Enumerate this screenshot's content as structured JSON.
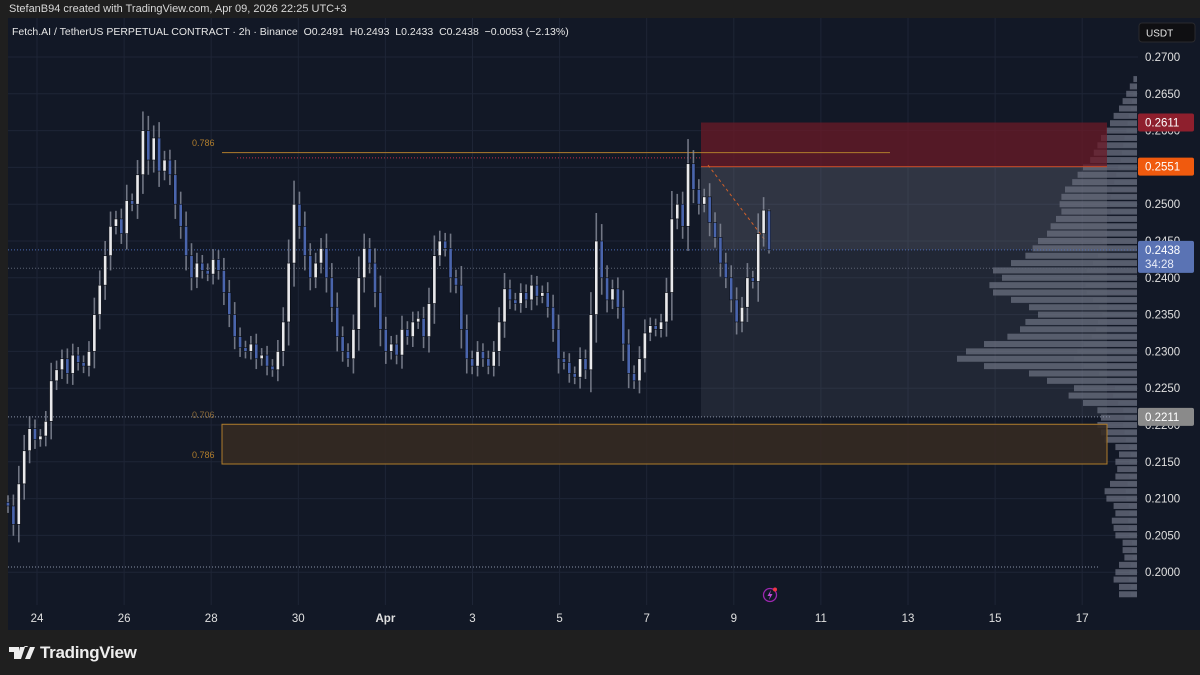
{
  "attribution": "StefanB94 created with TradingView.com, Apr 09, 2026 22:25 UTC+3",
  "legend": {
    "symbol": "Fetch.AI / TetherUS PERPETUAL CONTRACT · 2h · Binance",
    "open": "O0.2491",
    "high": "H0.2493",
    "low": "L0.2433",
    "close": "C0.2438",
    "change": "−0.0053 (−2.13%)"
  },
  "currency": "USDT",
  "footer": {
    "brand": "TradingView"
  },
  "colors": {
    "background": "#121826",
    "up_body": "#e9e9ec",
    "down_body": "#4a65ad",
    "wick": "#8a8f9c",
    "supply_zone": "#6b1a27",
    "fib_zone": "#352a22",
    "fib_line": "#b07d2c",
    "label_red": "#8e1f2d",
    "label_orange": "#f05a0e",
    "label_blue": "#5a73b4",
    "label_gray": "#8a8a8a"
  },
  "price_labels": [
    {
      "value": "0.2611",
      "kind": "red"
    },
    {
      "value": "0.2551",
      "kind": "orange"
    },
    {
      "value": "0.2438",
      "kind": "blue",
      "countdown": "34:28"
    },
    {
      "value": "0.2211",
      "kind": "gray"
    }
  ],
  "fib_labels": {
    "upper_level": "0.786",
    "lower_top": "0.706",
    "lower_bottom": "0.786"
  },
  "chart_data": {
    "type": "candlestick",
    "interval": "2h",
    "ylim": [
      0.1965,
      0.2745
    ],
    "y_ticks": [
      "0.2700",
      "0.2650",
      "0.2600",
      "0.2550",
      "0.2500",
      "0.2450",
      "0.2400",
      "0.2350",
      "0.2300",
      "0.2250",
      "0.2200",
      "0.2150",
      "0.2100",
      "0.2050",
      "0.2000"
    ],
    "x_ticks": [
      "24",
      "26",
      "28",
      "30",
      "Apr",
      "3",
      "5",
      "7",
      "9",
      "11",
      "13",
      "15",
      "17"
    ],
    "grid": true,
    "closes": [
      0.209,
      0.2065,
      0.212,
      0.2165,
      0.2195,
      0.218,
      0.2185,
      0.2205,
      0.226,
      0.2275,
      0.229,
      0.227,
      0.2295,
      0.2285,
      0.228,
      0.23,
      0.235,
      0.239,
      0.243,
      0.247,
      0.248,
      0.246,
      0.2505,
      0.25,
      0.254,
      0.26,
      0.256,
      0.259,
      0.2545,
      0.256,
      0.254,
      0.25,
      0.247,
      0.243,
      0.24,
      0.242,
      0.241,
      0.2405,
      0.2425,
      0.241,
      0.238,
      0.235,
      0.232,
      0.2305,
      0.23,
      0.231,
      0.229,
      0.2295,
      0.228,
      0.2275,
      0.23,
      0.234,
      0.242,
      0.25,
      0.247,
      0.243,
      0.24,
      0.242,
      0.244,
      0.24,
      0.236,
      0.232,
      0.23,
      0.229,
      0.233,
      0.24,
      0.244,
      0.242,
      0.238,
      0.233,
      0.23,
      0.231,
      0.2295,
      0.233,
      0.232,
      0.234,
      0.2345,
      0.232,
      0.2365,
      0.243,
      0.245,
      0.244,
      0.24,
      0.239,
      0.233,
      0.229,
      0.228,
      0.23,
      0.229,
      0.228,
      0.23,
      0.234,
      0.2385,
      0.237,
      0.2365,
      0.238,
      0.237,
      0.239,
      0.2375,
      0.238,
      0.236,
      0.233,
      0.229,
      0.2285,
      0.227,
      0.2265,
      0.229,
      0.2275,
      0.235,
      0.245,
      0.24,
      0.237,
      0.2385,
      0.236,
      0.231,
      0.227,
      0.226,
      0.229,
      0.2325,
      0.2335,
      0.233,
      0.234,
      0.238,
      0.248,
      0.25,
      0.247,
      0.2555,
      0.252,
      0.25,
      0.251,
      0.2475,
      0.2455,
      0.242,
      0.24,
      0.237,
      0.234,
      0.236,
      0.24,
      0.2395,
      0.246,
      0.2492,
      0.2438
    ],
    "last": {
      "open": 0.2491,
      "high": 0.2493,
      "low": 0.2433,
      "close": 0.2438
    },
    "zones": {
      "supply": [
        0.2551,
        0.2611
      ],
      "position_range": [
        0.2211,
        0.2551
      ],
      "fib_box": [
        0.2147,
        0.2201
      ],
      "fib_786_line": 0.257
    },
    "volume_profile": [
      [
        0.267,
        0.02
      ],
      [
        0.266,
        0.04
      ],
      [
        0.265,
        0.06
      ],
      [
        0.264,
        0.08
      ],
      [
        0.263,
        0.1
      ],
      [
        0.262,
        0.13
      ],
      [
        0.261,
        0.15
      ],
      [
        0.26,
        0.17
      ],
      [
        0.259,
        0.2
      ],
      [
        0.258,
        0.22
      ],
      [
        0.257,
        0.24
      ],
      [
        0.256,
        0.26
      ],
      [
        0.255,
        0.3
      ],
      [
        0.254,
        0.33
      ],
      [
        0.253,
        0.36
      ],
      [
        0.252,
        0.4
      ],
      [
        0.251,
        0.42
      ],
      [
        0.25,
        0.43
      ],
      [
        0.249,
        0.42
      ],
      [
        0.248,
        0.45
      ],
      [
        0.247,
        0.48
      ],
      [
        0.246,
        0.5
      ],
      [
        0.245,
        0.55
      ],
      [
        0.244,
        0.58
      ],
      [
        0.243,
        0.62
      ],
      [
        0.242,
        0.7
      ],
      [
        0.241,
        0.8
      ],
      [
        0.24,
        0.75
      ],
      [
        0.239,
        0.82
      ],
      [
        0.238,
        0.8
      ],
      [
        0.237,
        0.7
      ],
      [
        0.236,
        0.6
      ],
      [
        0.235,
        0.55
      ],
      [
        0.234,
        0.62
      ],
      [
        0.233,
        0.65
      ],
      [
        0.232,
        0.72
      ],
      [
        0.231,
        0.85
      ],
      [
        0.23,
        0.95
      ],
      [
        0.229,
        1.0
      ],
      [
        0.228,
        0.85
      ],
      [
        0.227,
        0.6
      ],
      [
        0.226,
        0.5
      ],
      [
        0.225,
        0.35
      ],
      [
        0.224,
        0.38
      ],
      [
        0.223,
        0.3
      ],
      [
        0.222,
        0.22
      ],
      [
        0.221,
        0.2
      ],
      [
        0.22,
        0.22
      ],
      [
        0.219,
        0.2
      ],
      [
        0.218,
        0.18
      ],
      [
        0.217,
        0.12
      ],
      [
        0.216,
        0.1
      ],
      [
        0.215,
        0.12
      ],
      [
        0.214,
        0.11
      ],
      [
        0.213,
        0.12
      ],
      [
        0.212,
        0.15
      ],
      [
        0.211,
        0.18
      ],
      [
        0.21,
        0.17
      ],
      [
        0.209,
        0.13
      ],
      [
        0.208,
        0.12
      ],
      [
        0.207,
        0.14
      ],
      [
        0.206,
        0.13
      ],
      [
        0.205,
        0.12
      ],
      [
        0.204,
        0.08
      ],
      [
        0.203,
        0.08
      ],
      [
        0.202,
        0.07
      ],
      [
        0.201,
        0.1
      ],
      [
        0.2,
        0.12
      ],
      [
        0.199,
        0.13
      ],
      [
        0.198,
        0.1
      ],
      [
        0.197,
        0.1
      ]
    ]
  }
}
